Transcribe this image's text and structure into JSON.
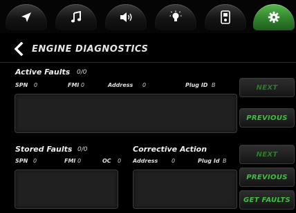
{
  "page": {
    "title": "ENGINE DIAGNOSTICS",
    "back_icon": "chevron-left-icon"
  },
  "tabs": [
    {
      "name": "navigation",
      "icon": "navigation-arrow-icon",
      "active": false
    },
    {
      "name": "music",
      "icon": "music-note-icon",
      "active": false
    },
    {
      "name": "audio",
      "icon": "speaker-icon",
      "active": false
    },
    {
      "name": "lights",
      "icon": "lightbulb-icon",
      "active": false
    },
    {
      "name": "device",
      "icon": "phone-device-icon",
      "active": false
    },
    {
      "name": "settings",
      "icon": "gear-icon",
      "active": true
    }
  ],
  "active_faults": {
    "title": "Active Faults",
    "count": "0/0",
    "spn_label": "SPN",
    "spn_value": "0",
    "fmi_label": "FMI",
    "fmi_value": "0",
    "address_label": "Address",
    "address_value": "0",
    "plug_label": "Plug ID",
    "plug_value": "B"
  },
  "stored_faults": {
    "title": "Stored Faults",
    "count": "0/0",
    "spn_label": "SPN",
    "spn_value": "0",
    "fmi_label": "FMI",
    "fmi_value": "0",
    "oc_label": "OC",
    "oc_value": "0"
  },
  "corrective_action": {
    "title": "Corrective Action",
    "address_label": "Address",
    "address_value": "0",
    "plug_label": "Plug Id",
    "plug_value": "B"
  },
  "buttons": {
    "next_active": "NEXT",
    "previous_active": "PREVIOUS",
    "next_stored": "NEXT",
    "previous_stored": "PREVIOUS",
    "get_faults": "GET FAULTS"
  },
  "colors": {
    "accent_green": "#3fbf3f",
    "active_tab_green": "#3f9a38",
    "background": "#000000"
  }
}
